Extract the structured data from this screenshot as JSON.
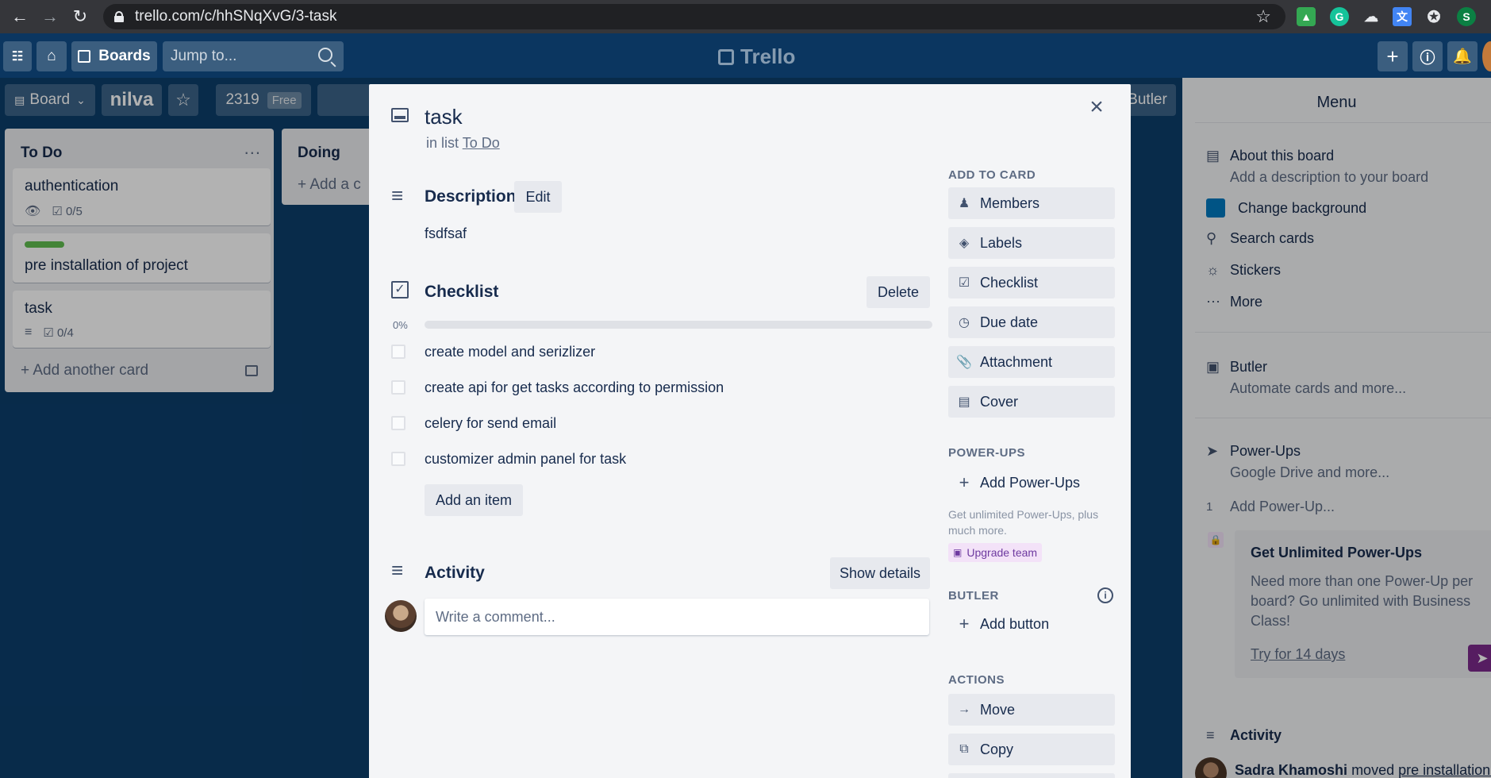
{
  "browser": {
    "url": "trello.com/c/hhSNqXvG/3-task",
    "profile_initial": "S"
  },
  "header": {
    "boards_label": "Boards",
    "jump_placeholder": "Jump to...",
    "logo_text": "Trello"
  },
  "board_bar": {
    "view_label": "Board",
    "board_name": "nilva",
    "team_id": "2319",
    "plan_tag": "Free",
    "butler_label": "Butler"
  },
  "lists": [
    {
      "title": "To Do",
      "menu": "...",
      "cards": [
        {
          "title": "authentication",
          "checklist": "0/5"
        },
        {
          "title": "pre installation of project",
          "label_color": "#61bd4f"
        },
        {
          "title": "task",
          "checklist": "0/4"
        }
      ],
      "add_label": "Add another card"
    },
    {
      "title": "Doing",
      "add_label": "Add a c"
    }
  ],
  "modal": {
    "title": "task",
    "in_list_prefix": "in list",
    "list_name": "To Do",
    "description_heading": "Description",
    "edit_label": "Edit",
    "description_text": "fsdfsaf",
    "checklist_heading": "Checklist",
    "delete_label": "Delete",
    "progress_label": "0%",
    "progress_fraction": 0,
    "checklist_items": [
      "create model and serizlizer",
      "create api for get tasks according to permission",
      "celery for send email",
      "customizer admin panel for task"
    ],
    "add_item_label": "Add an item",
    "activity_heading": "Activity",
    "show_details_label": "Show details",
    "comment_placeholder": "Write a comment..."
  },
  "card_sidebar": {
    "add_to_card_heading": "ADD TO CARD",
    "add_to_card": [
      "Members",
      "Labels",
      "Checklist",
      "Due date",
      "Attachment",
      "Cover"
    ],
    "powerups_heading": "POWER-UPS",
    "add_powerups_label": "Add Power-Ups",
    "powerups_note": "Get unlimited Power-Ups, plus much more.",
    "upgrade_label": "Upgrade team",
    "butler_heading": "BUTLER",
    "add_button_label": "Add button",
    "actions_heading": "ACTIONS",
    "actions": [
      "Move",
      "Copy"
    ]
  },
  "menu": {
    "title": "Menu",
    "about_title": "About this board",
    "about_sub": "Add a description to your board",
    "change_background": "Change background",
    "background_color": "#0079bf",
    "search_cards": "Search cards",
    "stickers": "Stickers",
    "more": "More",
    "butler_title": "Butler",
    "butler_sub": "Automate cards and more...",
    "powerups_title": "Power-Ups",
    "powerups_sub": "Google Drive and more...",
    "powerup_count": "1",
    "add_powerup": "Add Power-Up...",
    "promo_title": "Get Unlimited Power-Ups",
    "promo_text": "Need more than one Power-Up per board? Go unlimited with Business Class!",
    "promo_link": "Try for 14 days",
    "activity_title": "Activity",
    "activity_user": "Sadra Khamoshi",
    "activity_verb": "moved",
    "activity_object": "pre installation o"
  }
}
